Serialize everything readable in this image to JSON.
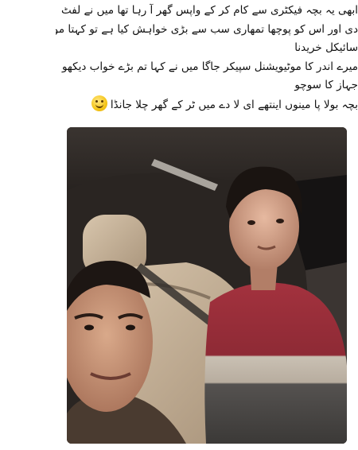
{
  "post": {
    "caption_lines": [
      "ابھی یہ بچہ فیکٹری سے کام کر کے واپس گھر آ رہا تھا میں نے لفٹ",
      "دی اور اس کو پوچھا تمھاری سب سے بڑی خواہش کیا ہے تو کہتا موٹر",
      "سائیکل خریدنا",
      "میرے اندر کا موٹیویشنل سپیکر جاگا میں نے کہا تم بڑے خواب دیکھو",
      "جہاز کا سوچو",
      "بچہ بولا پا مینوں اینتھے ای لا دے میں ٹر کے گھر چلا جانڈا"
    ],
    "emoji": "smiling-face-icon",
    "photo": "selfie-in-car"
  },
  "colors": {
    "background": "#ffffff",
    "text": "#111111",
    "car_interior": "#2a2522",
    "jacket_red": "#9b2f3a",
    "jacket_grey": "#6e6a66"
  }
}
